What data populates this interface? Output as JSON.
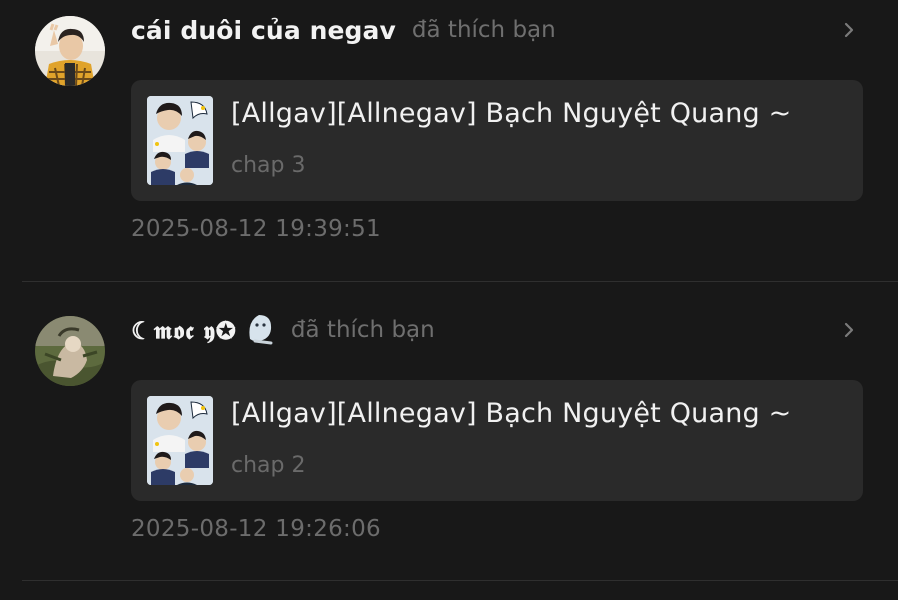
{
  "notifications": [
    {
      "username": "cái duôi của negav",
      "action": "đã thích bạn",
      "story_title": "[Allgav][Allnegav] Bạch Nguyệt Quang ~",
      "chapter": "chap 3",
      "timestamp": "2025-08-12 19:39:51",
      "avatar_icon": "user-avatar-photo",
      "cover_icon": "story-cover-image"
    },
    {
      "username": "☾𝖒𝖔𝖈 𝖞✪",
      "username_emoji": "ghost-sticker-icon",
      "action": "đã thích bạn",
      "story_title": "[Allgav][Allnegav] Bạch Nguyệt Quang ~",
      "chapter": "chap 2",
      "timestamp": "2025-08-12 19:26:06",
      "avatar_icon": "user-avatar-photo",
      "cover_icon": "story-cover-image"
    }
  ],
  "colors": {
    "background": "#181818",
    "card": "#2a2a2a",
    "muted_text": "#6c6c6c",
    "primary_text": "#f1f1f1"
  }
}
